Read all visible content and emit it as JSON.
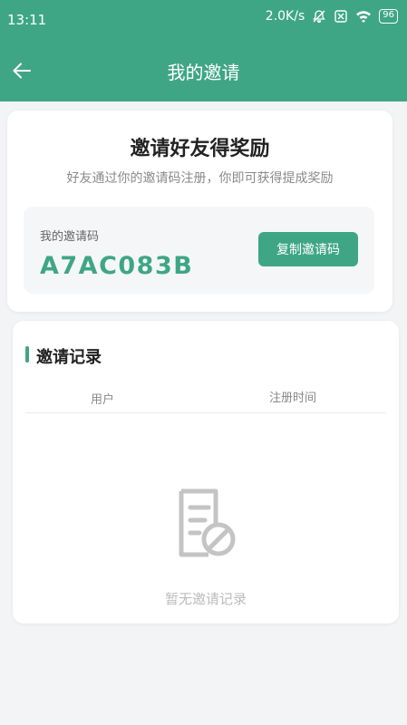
{
  "status_bar": {
    "time": "13:11",
    "network_speed": "2.0K/s",
    "battery": "96",
    "icons": [
      "bell-mute-icon",
      "sim-icon",
      "wifi-icon",
      "battery-icon"
    ]
  },
  "header": {
    "title": "我的邀请",
    "back_icon": "arrow-left-icon"
  },
  "invite": {
    "title": "邀请好友得奖励",
    "subtitle": "好友通过你的邀请码注册，你即可获得提成奖励",
    "code_label": "我的邀请码",
    "code": "A7AC083B",
    "copy_button": "复制邀请码"
  },
  "records": {
    "title": "邀请记录",
    "columns": [
      "用户",
      "注册时间"
    ],
    "rows": [],
    "empty_text": "暂无邀请记录",
    "empty_icon": "document-forbidden-icon"
  },
  "colors": {
    "primary": "#3fa685",
    "background": "#f3f4f6",
    "card": "#ffffff"
  }
}
